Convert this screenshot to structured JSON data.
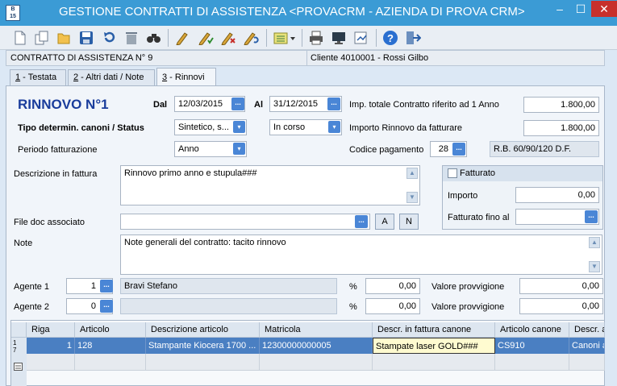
{
  "window": {
    "title": "GESTIONE CONTRATTI DI ASSISTENZA <PROVACRM - AZIENDA DI PROVA CRM>",
    "icon_text": "B\n15",
    "min": "–",
    "max": "☐",
    "close": "✕"
  },
  "toolbar": {
    "icons": [
      "new-document-icon",
      "copy-icon",
      "open-folder-icon",
      "save-icon",
      "undo-icon",
      "delete-icon",
      "search-icon",
      "edit-icon",
      "edit-check-icon",
      "edit-x-icon",
      "edit-undo-icon",
      "list-dropdown-icon",
      "print-icon",
      "monitor-icon",
      "export-icon",
      "help-icon",
      "exit-icon"
    ]
  },
  "info": {
    "contract": "CONTRATTO DI ASSISTENZA N° 9",
    "client": "Cliente 4010001 - Rossi Gilbo"
  },
  "tabs": [
    {
      "key": "1",
      "label": " - Testata"
    },
    {
      "key": "2",
      "label": " - Altri dati / Note"
    },
    {
      "key": "3",
      "label": " - Rinnovi"
    }
  ],
  "form": {
    "heading": "RINNOVO N°1",
    "dal_label": "Dal",
    "dal": "12/03/2015",
    "al_label": "Al",
    "al": "31/12/2015",
    "imp_tot_label": "Imp. totale Contratto riferito ad 1 Anno",
    "imp_tot": "1.800,00",
    "tipo_label": "Tipo determin. canoni / Status",
    "tipo": "Sintetico, s...",
    "status": "In corso",
    "imp_rinnovo_label": "Importo Rinnovo da fatturare",
    "imp_rinnovo": "1.800,00",
    "periodo_label": "Periodo fatturazione",
    "periodo": "Anno",
    "codpag_label": "Codice pagamento",
    "codpag": "28",
    "codpag_desc": "R.B. 60/90/120 D.F.",
    "descr_label": "Descrizione in fattura",
    "descr": "Rinnovo primo anno e stupula###",
    "fatturato_label": "Fatturato",
    "importo_label": "Importo",
    "importo": "0,00",
    "fatt_fino_label": "Fatturato fino al",
    "fatt_fino": "",
    "file_label": "File doc associato",
    "file": "",
    "btn_a": "A",
    "btn_n": "N",
    "note_label": "Note",
    "note": "Note generali del contratto: tacito rinnovo",
    "agente1_label": "Agente 1",
    "agente1": "1",
    "agente1_name": "Bravi Stefano",
    "pct1": "0,00",
    "prov1_label": "Valore provvigione",
    "prov1": "0,00",
    "agente2_label": "Agente 2",
    "agente2": "0",
    "agente2_name": "",
    "pct2": "0,00",
    "prov2_label": "Valore provvigione",
    "prov2": "0,00",
    "pct_sign": "%",
    "dots": "...",
    "dd_arrow": "▾",
    "up_arrow": "▲",
    "down_arrow": "▼"
  },
  "grid": {
    "headers": [
      "Riga",
      "Articolo",
      "Descrizione articolo",
      "Matricola",
      "Descr. in fattura canone",
      "Articolo canone",
      "Descr. a"
    ],
    "row": {
      "marker": "1\n7",
      "riga": "1",
      "articolo": "128",
      "descrizione": "Stampante Kiocera 1700 ...",
      "matricola": "12300000000005",
      "descr_fattura": "Stampate laser GOLD###",
      "art_canone": "CS910",
      "descr_a": "Canoni a"
    }
  },
  "colors": {
    "titlebar": "#3b9bd5",
    "heading": "#1a3d9c",
    "selection": "#4a7fc2",
    "accent": "#4a86d6"
  }
}
